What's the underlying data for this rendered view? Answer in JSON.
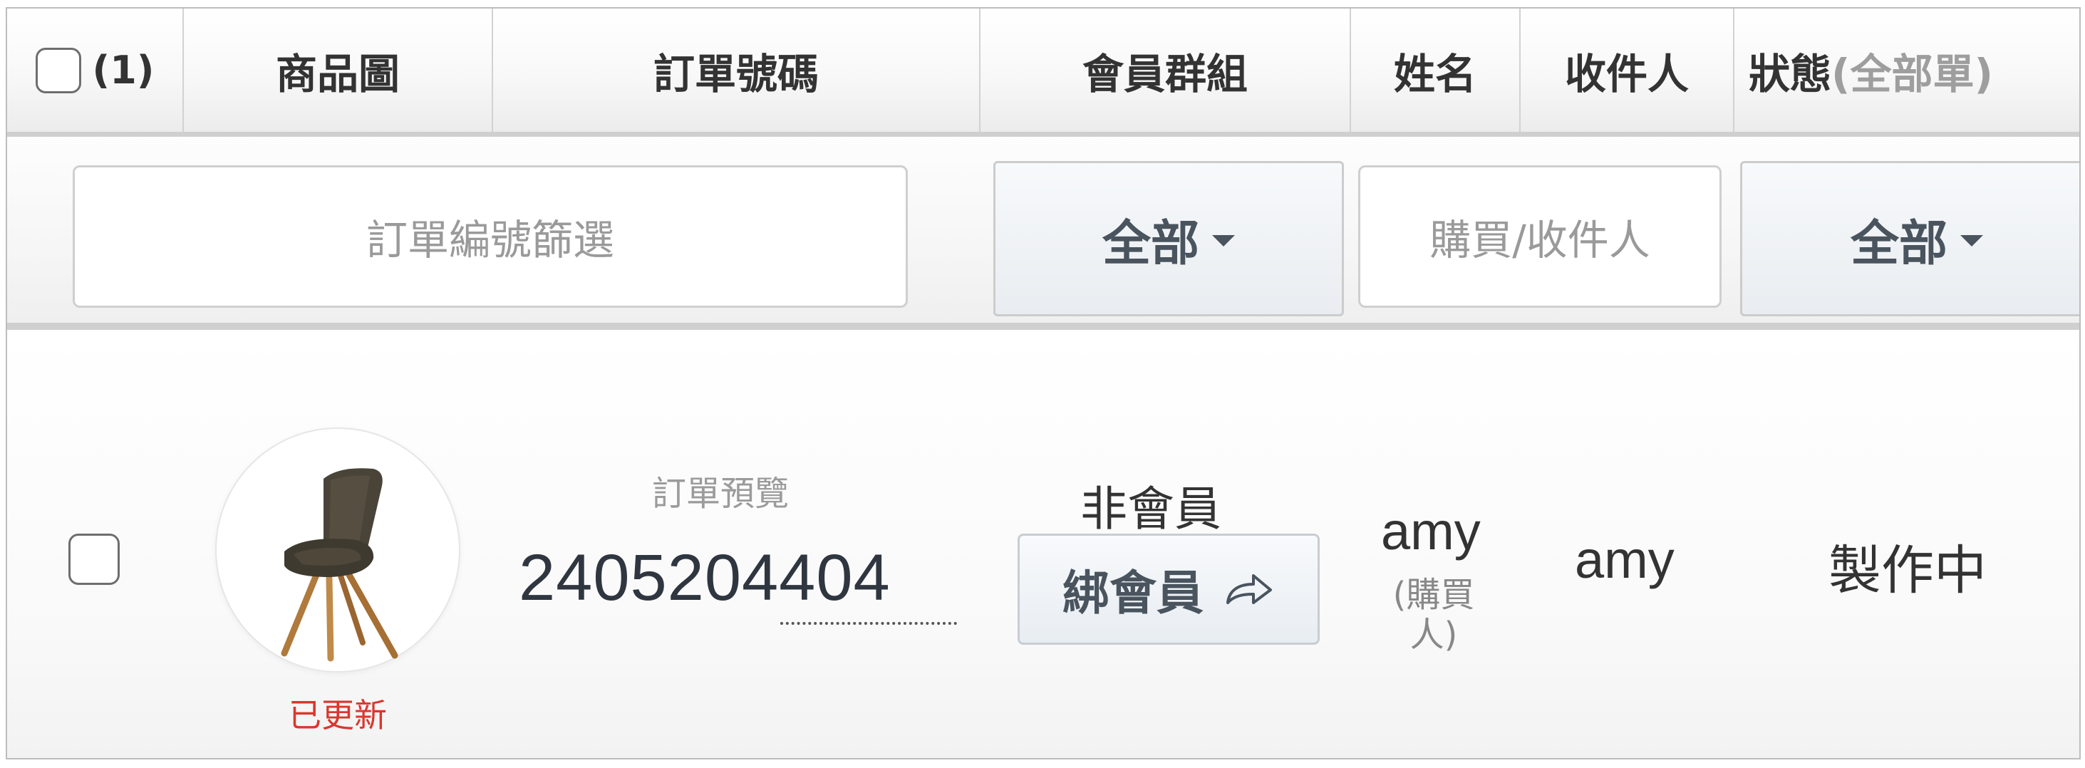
{
  "header": {
    "selected_count": "(1)",
    "columns": {
      "image": "商品圖",
      "order_no": "訂單號碼",
      "member_group": "會員群組",
      "name": "姓名",
      "recipient": "收件人",
      "status": "狀態",
      "status_filter": "(全部單)"
    }
  },
  "filters": {
    "order_placeholder": "訂單編號篩選",
    "group_select": "全部",
    "buyer_placeholder": "購買/收件人",
    "status_select": "全部"
  },
  "order": {
    "image_status": "已更新",
    "preview_label": "訂單預覽",
    "order_no_prefix": "240520",
    "order_no_suffix": "4404",
    "member_group": "非會員",
    "bind_button": "綁會員",
    "name": "amy",
    "name_role": "(購買人)",
    "recipient": "amy",
    "status": "製作中"
  }
}
